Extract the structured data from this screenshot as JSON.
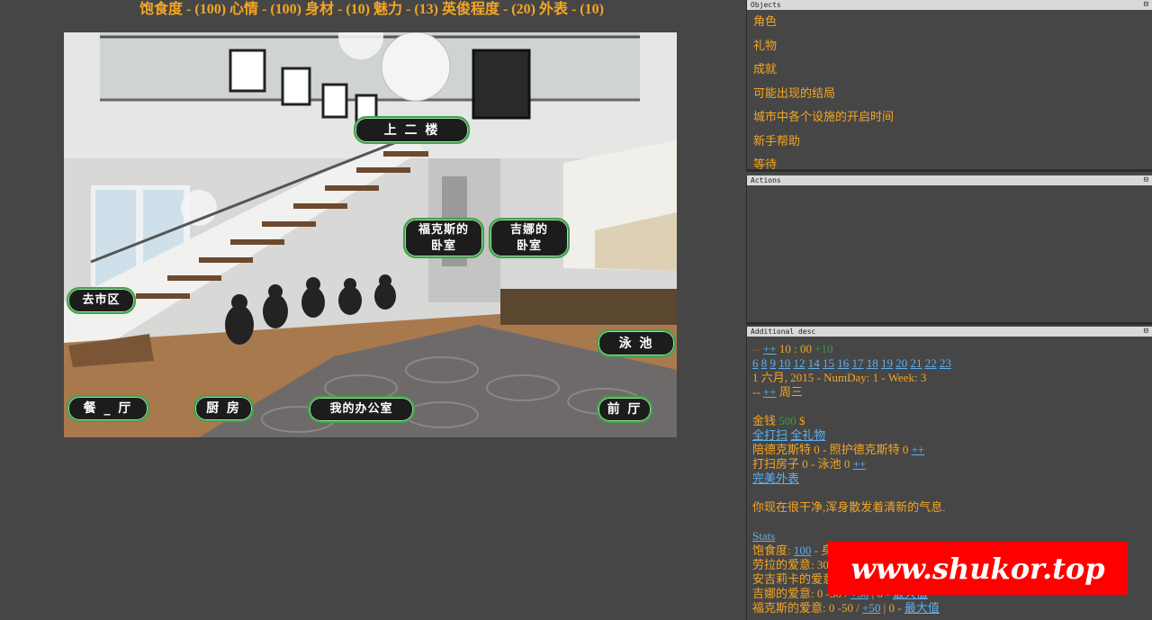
{
  "header": {
    "stats_line": "饱食度 - (100) 心情 - (100) 身材 - (10) 魅力 - (13) 英俊程度 - (20) 外表 - (10)"
  },
  "scene": {
    "hotspots": {
      "upstairs": "上 二 楼",
      "fox_bedroom": "福克斯的\n卧室",
      "jina_bedroom": "吉娜的\n卧室",
      "downtown": "去市区",
      "pool": "泳  池",
      "dining": "餐 _ 厅",
      "kitchen": "厨 房",
      "office": "我的办公室",
      "lobby": "前 厅"
    }
  },
  "objects_panel": {
    "title": "Objects",
    "items": [
      "角色",
      "礼物",
      "成就",
      "可能出现的结局",
      "城市中各个设施的开启时间",
      "新手帮助",
      "等待"
    ]
  },
  "actions_panel": {
    "title": "Actions"
  },
  "desc_panel": {
    "title": "Additional desc",
    "time_prefix_red": "--",
    "time_link": "++",
    "time_text": "10 : 00",
    "time_green": "+10",
    "hours": [
      "6",
      "8",
      "9",
      "10",
      "12",
      "14",
      "15",
      "16",
      "17",
      "18",
      "19",
      "20",
      "21",
      "22",
      "23"
    ],
    "date_line": "1 六月, 2015 - NumDay: 1 - Week: 3",
    "weekday_prefix": "--",
    "weekday_link": "++",
    "weekday_text": "周三",
    "money_label": "金钱",
    "money_value": "500",
    "money_unit": "$",
    "clean_all_link": "全打扫",
    "all_gifts_link": "全礼物",
    "accompany_line": "陪德克斯特 0 - 照护德克斯特 0",
    "accompany_link": "++",
    "clean_line": "打扫房子 0 - 泳池 0",
    "clean_link": "++",
    "perfect_look_link": "完美外表",
    "status_message": "你现在很干净,浑身散发着清新的气息.",
    "stats_link": "Stats",
    "satiety_label": "饱食度:",
    "satiety_value": "100",
    "satiety_rest": "- 身",
    "laura_line": "劳拉的爱意: 30",
    "angelica_line": "安吉莉卡的爱意",
    "jina_line": "吉娜的爱意: 0 -50 /",
    "jina_plus": "+50",
    "jina_mid": "| 0 -",
    "jina_max": "最大值",
    "fox_line": "福克斯的爱意: 0 -50 /",
    "fox_plus": "+50",
    "fox_mid": "| 0 -",
    "fox_max": "最大值"
  },
  "watermark": {
    "text": "www.shukor.top"
  }
}
